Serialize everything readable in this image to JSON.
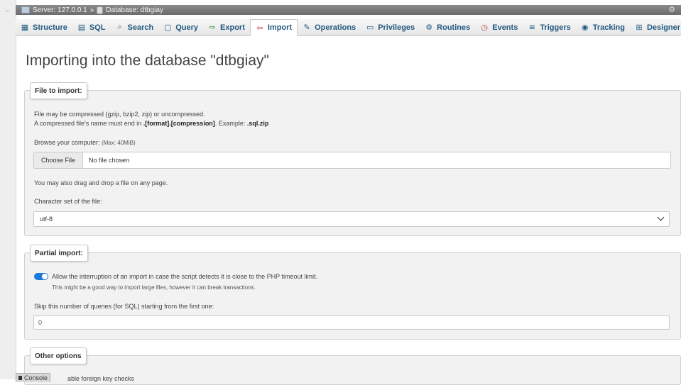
{
  "breadcrumb": {
    "server": "Server: 127.0.0.1",
    "separator": "»",
    "database": "Database: dtbgiay"
  },
  "tabs": [
    {
      "label": "Structure",
      "icon": "structure-icon"
    },
    {
      "label": "SQL",
      "icon": "sql-icon"
    },
    {
      "label": "Search",
      "icon": "search-icon"
    },
    {
      "label": "Query",
      "icon": "query-icon"
    },
    {
      "label": "Export",
      "icon": "export-icon"
    },
    {
      "label": "Import",
      "icon": "import-icon",
      "active": true
    },
    {
      "label": "Operations",
      "icon": "operations-icon"
    },
    {
      "label": "Privileges",
      "icon": "privileges-icon"
    },
    {
      "label": "Routines",
      "icon": "routines-icon"
    },
    {
      "label": "Events",
      "icon": "events-icon"
    },
    {
      "label": "Triggers",
      "icon": "triggers-icon"
    },
    {
      "label": "Tracking",
      "icon": "tracking-icon"
    },
    {
      "label": "Designer",
      "icon": "designer-icon"
    }
  ],
  "page_title": "Importing into the database \"dtbgiay\"",
  "file_to_import": {
    "legend": "File to import:",
    "line1": "File may be compressed (gzip, bzip2, zip) or uncompressed.",
    "line2_prefix": "A compressed file's name must end in ",
    "line2_format": ".[format].[compression]",
    "line2_mid": ". Example: ",
    "line2_example": ".sql.zip",
    "browse_label": "Browse your computer:",
    "max_size": "(Max: 40MiB)",
    "choose_button": "Choose File",
    "file_status": "No file chosen",
    "drag_text": "You may also drag and drop a file on any page.",
    "charset_label": "Character set of the file:",
    "charset_value": "utf-8"
  },
  "partial_import": {
    "legend": "Partial import:",
    "toggle_on": true,
    "allow_text": "Allow the interruption of an import in case the script detects it is close to the PHP timeout limit.",
    "allow_hint": "This might be a good way to import large files, however it can break transactions.",
    "skip_label": "Skip this number of queries (for SQL) starting from the first one:",
    "skip_value": "0"
  },
  "other_options": {
    "legend": "Other options",
    "partial_text": "able foreign key checks"
  },
  "console": {
    "label": "Console"
  },
  "colors": {
    "link": "#235a81",
    "toggle": "#1e7ad8",
    "topbar": "#7a7a7a"
  }
}
